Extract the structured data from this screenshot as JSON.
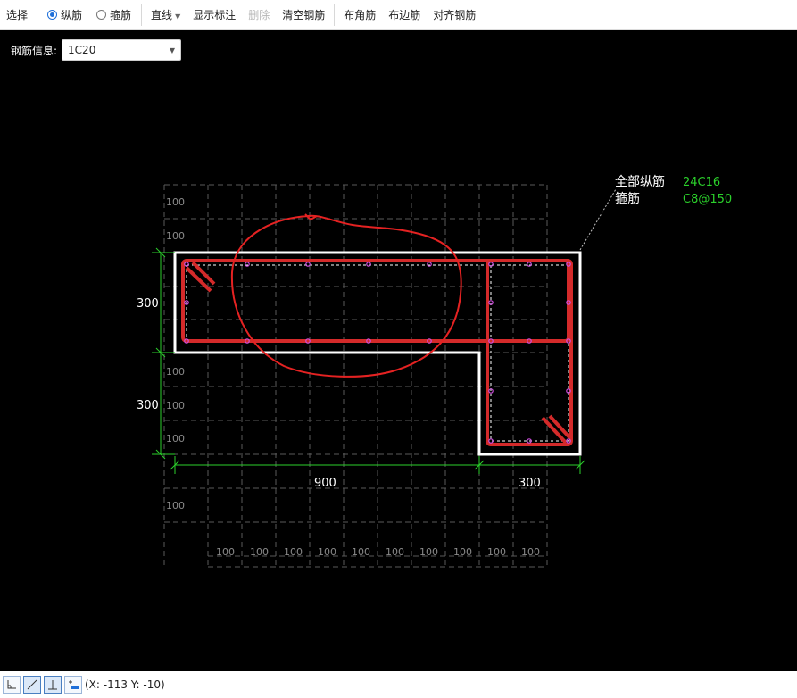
{
  "toolbar": {
    "select": "选择",
    "radio_longitudinal": "纵筋",
    "radio_stirrup": "箍筋",
    "line": "直线",
    "show_annotation": "显示标注",
    "delete": "删除",
    "clear_rebar": "清空钢筋",
    "corner_rebar": "布角筋",
    "edge_rebar": "布边筋",
    "align_rebar": "对齐钢筋"
  },
  "rebar_info": {
    "label": "钢筋信息:",
    "value": "1C20"
  },
  "canvas": {
    "grid_label": "100",
    "dim_left_top": "300",
    "dim_left_bottom": "300",
    "dim_bottom_left": "900",
    "dim_bottom_right": "300",
    "annotation": {
      "all_longitudinal_label": "全部纵筋",
      "all_longitudinal_value": "24C16",
      "stirrup_label": "箍筋",
      "stirrup_value": "C8@150"
    }
  },
  "status": {
    "coords": "(X: -113 Y: -10)"
  },
  "colors": {
    "rebar": "#d42a2a",
    "dimension": "#2bd12b",
    "annotation_value": "#2bd12b",
    "outline": "#ffffff",
    "grid": "#5a5a5a",
    "selection_accent": "#1e6fd9"
  }
}
